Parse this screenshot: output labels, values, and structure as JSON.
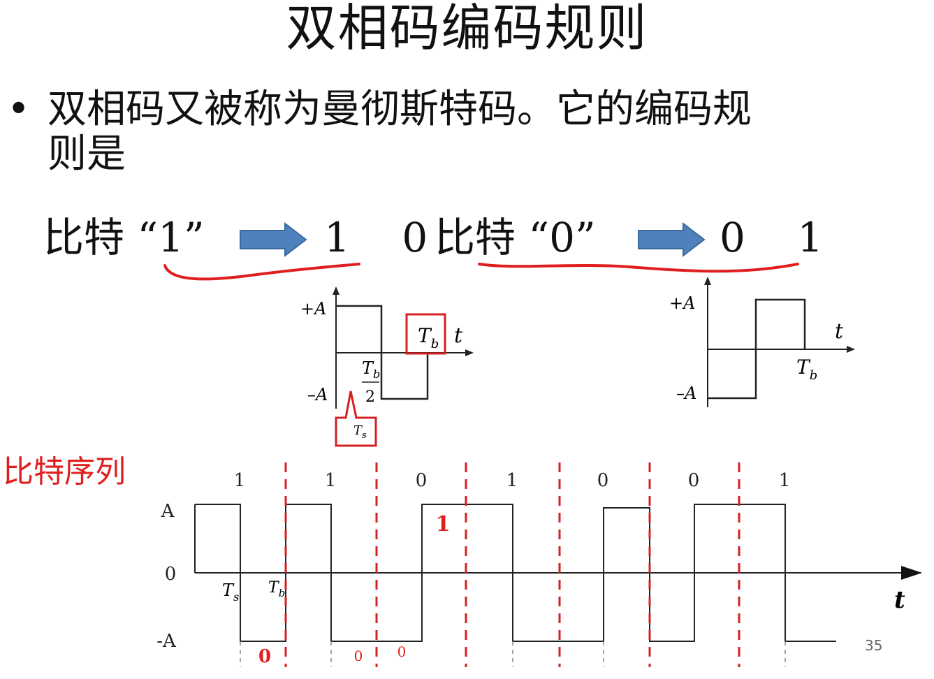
{
  "title": "双相码编码规则",
  "bullet": {
    "line1": "双相码又被称为曼彻斯特码。它的编码规",
    "line2": "则是"
  },
  "rule_one": {
    "bit_label": "比特 “1”",
    "mapped": "1 0"
  },
  "rule_zero": {
    "bit_label": "比特 “0”",
    "mapped": "0 1"
  },
  "diagram_one": {
    "plus_a": "+A",
    "minus_a": "–A",
    "t": "t",
    "tb_main": "T",
    "tb_sub": "b",
    "tb_half_main": "T",
    "tb_half_sub": "b",
    "half_den": "2",
    "ts_main": "T",
    "ts_sub": "s"
  },
  "diagram_zero": {
    "plus_a": "+A",
    "minus_a": "–A",
    "t": "t",
    "tb_main": "T",
    "tb_sub": "b"
  },
  "sequence": {
    "label": "比特序列",
    "bits": [
      "1",
      "1",
      "0",
      "1",
      "0",
      "0",
      "1"
    ],
    "level_a": "A",
    "level_zero": "0",
    "level_neg_a": "-A",
    "t": "t",
    "ts_main": "T",
    "ts_sub": "s",
    "tb_main": "T",
    "tb_sub": "b",
    "annotations": [
      "0",
      "0",
      "0",
      "1"
    ]
  },
  "page_number": "35",
  "colors": {
    "arrow_fill": "#4f81bd",
    "accent_red": "#e01e1e",
    "waveform": "#222222"
  }
}
